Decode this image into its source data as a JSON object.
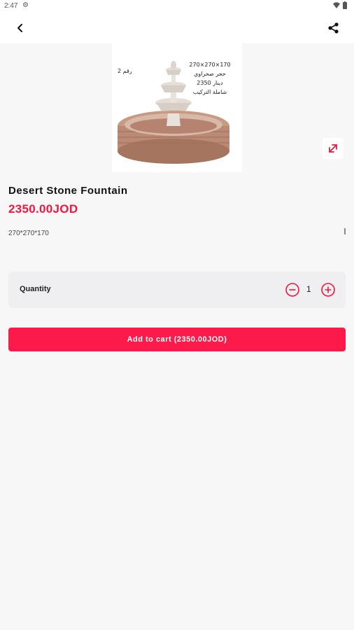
{
  "status_bar": {
    "time": "2:47"
  },
  "product": {
    "name": "Desert Stone Fountain",
    "price": "2350.00JOD",
    "description": "270*270*170",
    "image_caption": [
      "270×270×170",
      "حجر صحراوي",
      "2350 دينار",
      "شاملة التركيب"
    ],
    "image_tag": "رقم 2"
  },
  "quantity": {
    "label": "Quantity",
    "value": "1"
  },
  "add_to_cart": {
    "label": "Add to cart (2350.00JOD)"
  },
  "colors": {
    "accent": "#fb1a4a",
    "price": "#f2163e",
    "background": "#f7f7f8"
  }
}
